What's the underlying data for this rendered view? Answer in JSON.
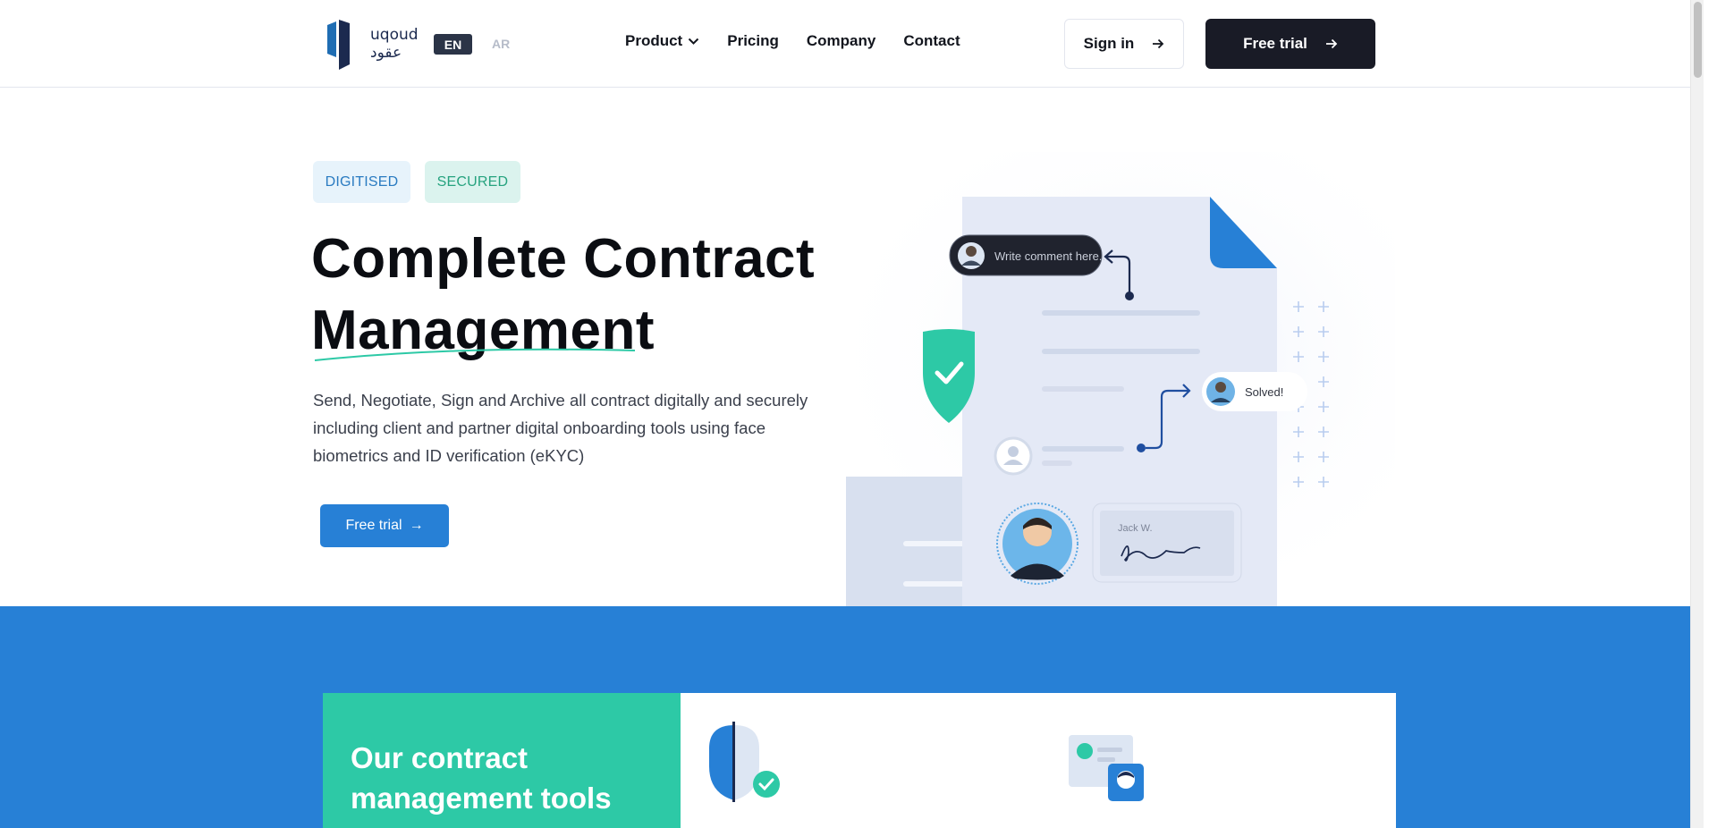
{
  "header": {
    "logo_text": "uqoud",
    "logo_arabic": "عقود",
    "lang_en": "EN",
    "lang_ar": "AR",
    "nav": [
      {
        "label": "Product",
        "has_dropdown": true
      },
      {
        "label": "Pricing"
      },
      {
        "label": "Company"
      },
      {
        "label": "Contact"
      }
    ],
    "signin_label": "Sign in",
    "freetrial_label": "Free trial"
  },
  "hero": {
    "badges": [
      "DIGITISED",
      "SECURED"
    ],
    "title_line1": "Complete Contract",
    "title_line2": "Management",
    "description": "Send, Negotiate, Sign and Archive all contract digitally and securely including client and partner digital onboarding tools using face biometrics and ID verification (eKYC)",
    "cta_label": "Free trial"
  },
  "illustration": {
    "comment_placeholder": "Write comment here...",
    "solved_label": "Solved!",
    "signature_name": "Jack W."
  },
  "tools": {
    "title_line1": "Our contract",
    "title_line2": "management tools"
  },
  "colors": {
    "brand_blue": "#2780d6",
    "brand_green": "#2dc9a6",
    "dark": "#191b26"
  }
}
